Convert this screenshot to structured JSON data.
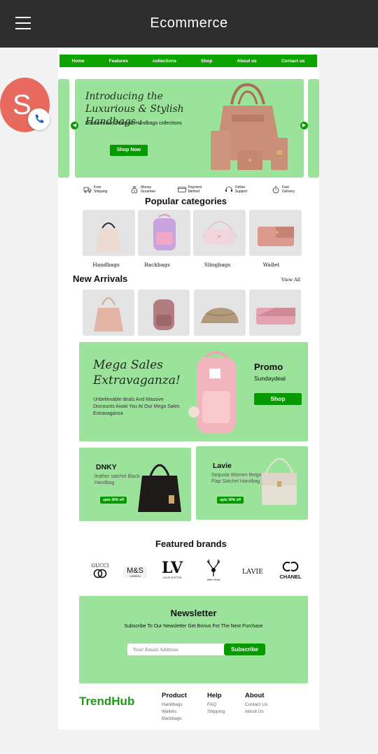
{
  "appbar": {
    "title": "Ecommerce",
    "menu_icon": "hamburger-menu-icon"
  },
  "nav": [
    "Home",
    "Features",
    "collections",
    "Shop",
    "About us",
    "Contact us"
  ],
  "hero": {
    "title": "Introducing the Luxurious & Stylish Handbags :",
    "subtitle": "Discover our Designer Handbags collections",
    "cta": "Shop Now"
  },
  "features": [
    {
      "icon": "truck-icon",
      "label": "Free Shipping"
    },
    {
      "icon": "money-bag-icon",
      "label": "Money Gurantee"
    },
    {
      "icon": "card-icon",
      "label": "Payment Method"
    },
    {
      "icon": "headset-icon",
      "label": "Online Support"
    },
    {
      "icon": "stopwatch-icon",
      "label": "Fast Delivery"
    }
  ],
  "popular": {
    "title": "Popular categories",
    "items": [
      "Handbags",
      "Backbags",
      "Slingbags",
      "Wallet"
    ]
  },
  "arrivals": {
    "title": "New Arrivals",
    "view_all": "View All"
  },
  "promo": {
    "title": "Mega Sales Extravaganza!",
    "desc": "Unbelievable deals And Massive Discounts Await You At Our Mega Sales Extravaganza",
    "promo_label": "Promo",
    "promo_code": "Sundaydeal",
    "cta": "Shop"
  },
  "cards": [
    {
      "name": "DNKY",
      "desc": "leather satchel Black Handbag",
      "badge": "upto 30% off"
    },
    {
      "name": "Lavie",
      "desc": "Sequola Women Beige Flap Satchel Handbag",
      "badge": "upto 30% off"
    }
  ],
  "brands": {
    "title": "Featured brands",
    "items": [
      "GUCCI",
      "M&S",
      "LOUIS VUITTON",
      "Allen Solly",
      "LAVIE",
      "CHANEL"
    ],
    "ms_sub": "LONDON"
  },
  "newsletter": {
    "title": "Newsletter",
    "text": "Subscribe To Our Newsletter Get Bonus For The Next Purchase",
    "placeholder": "Your Email Address",
    "cta": "Subscribe"
  },
  "footer": {
    "logo": "TrendHub",
    "cols": [
      {
        "title": "Product",
        "links": [
          "Handbags",
          "Wallets",
          "Backbags"
        ]
      },
      {
        "title": "Help",
        "links": [
          "FAQ",
          "Shipping"
        ]
      },
      {
        "title": "About",
        "links": [
          "Contact Us",
          "About Us"
        ]
      }
    ]
  },
  "overlay": {
    "avatar_letter": "S"
  },
  "colors": {
    "green": "#079a00",
    "light_green": "#9be39a",
    "appbar": "#2d2d2d",
    "avatar": "#e8695d"
  }
}
